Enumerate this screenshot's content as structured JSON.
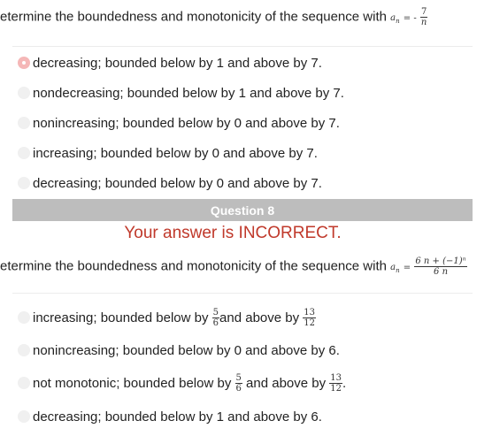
{
  "question7": {
    "prompt_prefix": "etermine the boundedness and monotonicity of the sequence with",
    "formula_var": "a",
    "formula_sub": "n",
    "formula_eq": "= -",
    "formula_num": "7",
    "formula_den": "n",
    "options": [
      {
        "label": "decreasing; bounded below by 1 and above by 7.",
        "selected": true
      },
      {
        "label": "nondecreasing; bounded below by 1 and above by 7.",
        "selected": false
      },
      {
        "label": "nonincreasing; bounded below by 0 and above by 7.",
        "selected": false
      },
      {
        "label": "increasing; bounded below by 0 and above by 7.",
        "selected": false
      },
      {
        "label": "decreasing; bounded below by 0 and above by 7.",
        "selected": false
      }
    ]
  },
  "question8": {
    "header": "Question 8",
    "result": "Your answer is INCORRECT.",
    "prompt_prefix": "etermine the boundedness and monotonicity of the sequence with",
    "formula_var": "a",
    "formula_sub": "n",
    "formula_eq": "=",
    "formula_num": "6 n + (−1)ⁿ",
    "formula_den": "6 n",
    "options": [
      {
        "pre": "increasing; bounded below by",
        "f1_num": "5",
        "f1_den": "6",
        "mid": "and above by",
        "f2_num": "13",
        "f2_den": "12",
        "post": ""
      },
      {
        "label": "nonincreasing; bounded below by 0 and above by 6."
      },
      {
        "pre": "not monotonic; bounded below by",
        "f1_num": "5",
        "f1_den": "6",
        "mid": "and above by",
        "f2_num": "13",
        "f2_den": "12",
        "post": "."
      },
      {
        "label": "decreasing; bounded below by 1 and above by 6."
      }
    ]
  },
  "colors": {
    "selected_radio": "#f5b7b7",
    "header_bg": "#bdbdbd",
    "incorrect_text": "#c0392b"
  }
}
